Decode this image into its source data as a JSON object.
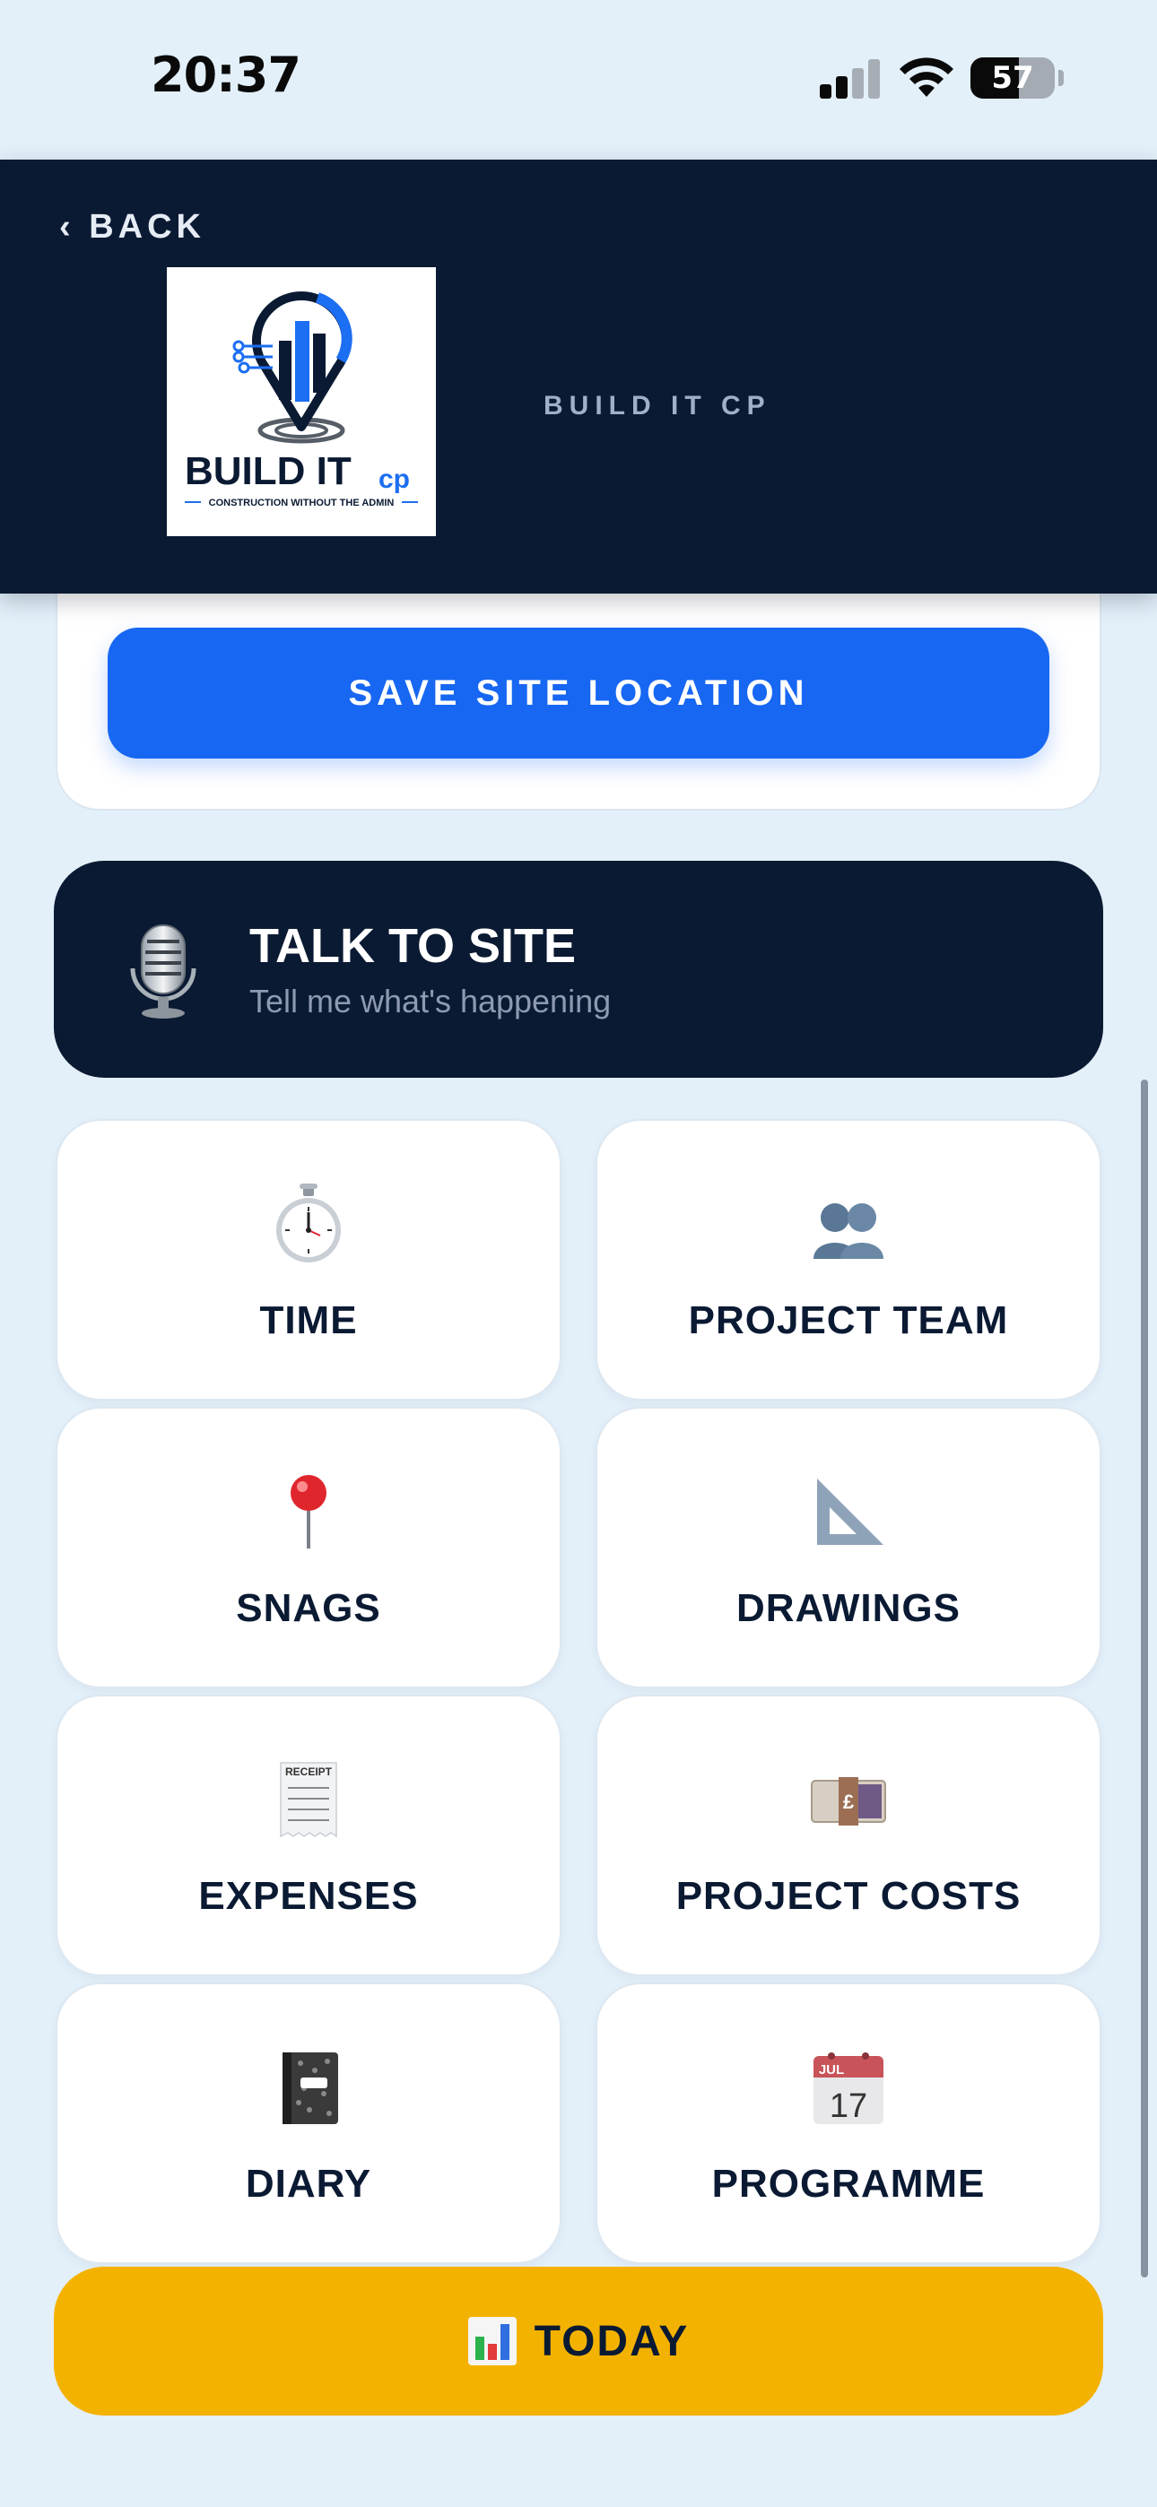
{
  "status_bar": {
    "time": "20:37",
    "battery_level": "57"
  },
  "header": {
    "back_label": "‹ BACK",
    "company_name": "BUILD IT CP",
    "logo": {
      "wordmark": "BUILD IT",
      "wordmark_suffix": "cp",
      "tagline": "CONSTRUCTION WITHOUT THE ADMIN"
    }
  },
  "location": {
    "save_label": "SAVE SITE LOCATION"
  },
  "talk": {
    "title": "TALK TO SITE",
    "subtitle": "Tell me what's happening",
    "icon": "microphone-icon"
  },
  "tiles": [
    {
      "label": "TIME",
      "icon": "stopwatch-icon"
    },
    {
      "label": "PROJECT TEAM",
      "icon": "people-icon"
    },
    {
      "label": "SNAGS",
      "icon": "pushpin-icon"
    },
    {
      "label": "DRAWINGS",
      "icon": "set-square-icon"
    },
    {
      "label": "EXPENSES",
      "icon": "receipt-icon"
    },
    {
      "label": "PROJECT COSTS",
      "icon": "banknote-icon"
    },
    {
      "label": "DIARY",
      "icon": "notebook-icon"
    },
    {
      "label": "PROGRAMME",
      "icon": "calendar-icon"
    }
  ],
  "calendar_icon": {
    "month": "JUL",
    "day": "17"
  },
  "receipt_icon": {
    "text": "RECEIPT"
  },
  "banknote_icon": {
    "symbol": "£"
  },
  "today": {
    "label": "TODAY",
    "icon": "bar-chart-icon"
  },
  "colors": {
    "navy": "#0b1a33",
    "primary_blue": "#1767f2",
    "today_yellow": "#f4b200",
    "background": "#e3f0fa"
  }
}
